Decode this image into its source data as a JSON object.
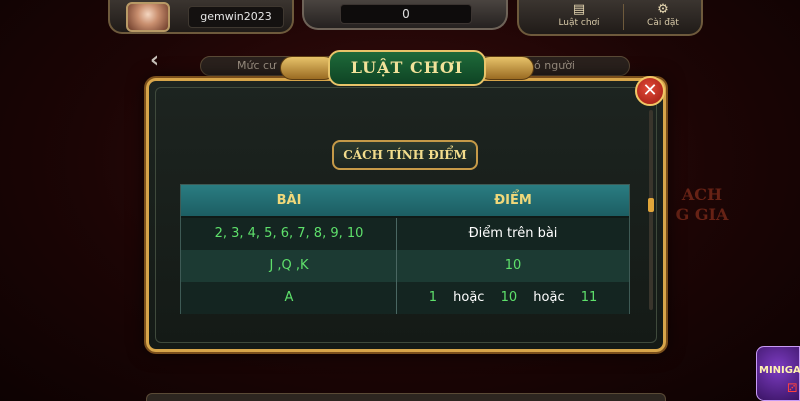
{
  "topbar": {
    "username": "gemwin2023",
    "balance": "0",
    "rules_label": "Luật chơi",
    "settings_label": "Cài đặt",
    "rules_icon": "book-icon",
    "settings_icon": "gear-icon"
  },
  "background": {
    "strip_left": "Mức cư",
    "strip_right": "ó người",
    "deco_text": "ACH\nG GIA"
  },
  "modal": {
    "title": "LUẬT CHƠI",
    "subtitle": "CÁCH TÍNH ĐIỂM",
    "close_glyph": "✕",
    "table": {
      "headers": [
        "BÀI",
        "ĐIỂM"
      ],
      "rows": [
        {
          "card": "2, 3, 4, 5, 6, 7, 8, 9, 10",
          "score": "Điểm trên bài"
        },
        {
          "card": "J ,Q ,K",
          "score": "10"
        },
        {
          "card": "A",
          "score_parts": [
            "1",
            "hoặc",
            "10",
            "hoặc",
            "11"
          ]
        }
      ]
    }
  },
  "minigame": {
    "label": "MINIGA"
  },
  "colors": {
    "accent_gold": "#d7a54a",
    "header_teal": "#2a7d82",
    "value_green": "#5ee06b",
    "close_red": "#c72a1c"
  }
}
